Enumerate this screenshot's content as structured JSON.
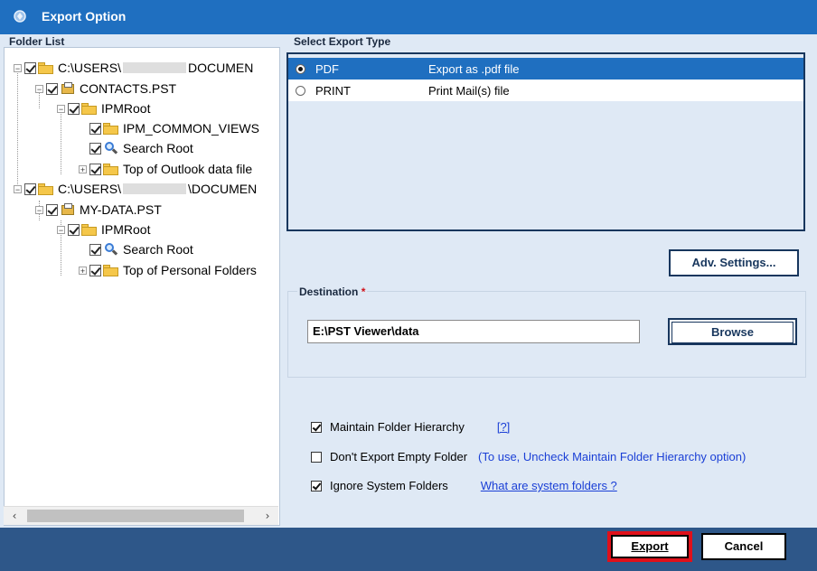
{
  "window": {
    "title": "Export Option",
    "icon": "app-logo-icon"
  },
  "folder_list": {
    "label": "Folder List",
    "items": [
      {
        "label": "C:\\USERS\\",
        "suffix": "DOCUMEN",
        "expander": "-",
        "icon": "folder-open-icon"
      },
      {
        "label": "CONTACTS.PST",
        "expander": "-",
        "icon": "pst-file-icon"
      },
      {
        "label": "IPMRoot",
        "expander": "-",
        "icon": "folder-icon"
      },
      {
        "label": "IPM_COMMON_VIEWS",
        "expander": "",
        "icon": "folder-icon"
      },
      {
        "label": "Search Root",
        "expander": "",
        "icon": "search-icon"
      },
      {
        "label": "Top of Outlook data file",
        "expander": "+",
        "icon": "folder-icon"
      },
      {
        "label": "C:\\USERS\\",
        "suffix": "\\DOCUMEN",
        "expander": "-",
        "icon": "folder-open-icon"
      },
      {
        "label": "MY-DATA.PST",
        "expander": "-",
        "icon": "pst-file-icon"
      },
      {
        "label": "IPMRoot",
        "expander": "-",
        "icon": "folder-icon"
      },
      {
        "label": "Search Root",
        "expander": "",
        "icon": "search-icon"
      },
      {
        "label": "Top of Personal Folders",
        "expander": "+",
        "icon": "folder-icon"
      }
    ]
  },
  "export_type": {
    "label": "Select Export Type",
    "options": [
      {
        "name": "PDF",
        "desc": "Export as .pdf file",
        "selected": true
      },
      {
        "name": "PRINT",
        "desc": "Print Mail(s) file",
        "selected": false
      }
    ]
  },
  "adv_settings_label": "Adv. Settings...",
  "destination": {
    "label": "Destination",
    "required_mark": "*",
    "value": "E:\\PST Viewer\\data",
    "browse_label": "Browse"
  },
  "options": {
    "maintain_hierarchy": {
      "label": "Maintain Folder Hierarchy",
      "checked": true,
      "help": "[?]"
    },
    "dont_export_empty": {
      "label": "Don't Export Empty Folder",
      "checked": false,
      "hint": "(To use, Uncheck Maintain Folder Hierarchy option)"
    },
    "ignore_system": {
      "label": "Ignore System Folders",
      "checked": true,
      "link": "What are system folders ?"
    }
  },
  "footer": {
    "export_label": "Export",
    "cancel_label": "Cancel"
  },
  "colors": {
    "titlebar": "#1f6fc0",
    "selection": "#1f6fc0",
    "footer": "#2e5789",
    "export_highlight": "#e0101a"
  }
}
